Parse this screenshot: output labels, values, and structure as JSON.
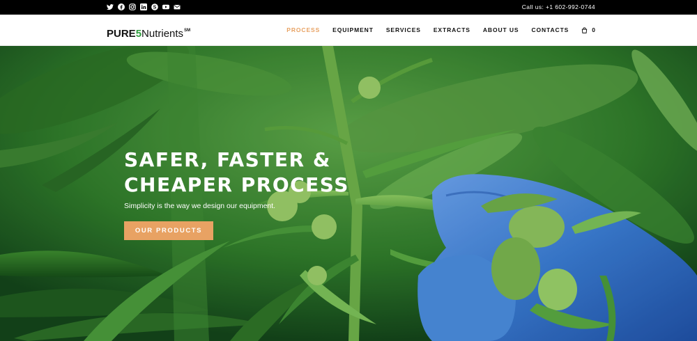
{
  "topbar": {
    "social_icons": [
      "twitter-icon",
      "facebook-icon",
      "instagram-icon",
      "linkedin-icon",
      "skype-icon",
      "youtube-icon",
      "email-icon"
    ],
    "call_text": "Call us: +1 602-992-0744"
  },
  "header": {
    "logo": {
      "part1": "PURE",
      "part2": "5",
      "part3": "Nutrients",
      "part4": "SM"
    },
    "nav": [
      {
        "label": "PROCESS",
        "active": true
      },
      {
        "label": "EQUIPMENT"
      },
      {
        "label": "SERVICES"
      },
      {
        "label": "EXTRACTS"
      },
      {
        "label": "ABOUT US"
      },
      {
        "label": "CONTACTS"
      }
    ],
    "cart_count": "0"
  },
  "hero": {
    "headline_line1": "SAFER, FASTER &",
    "headline_line2": "CHEAPER PROCESS",
    "subtext": "Simplicity is the way we design our equipment.",
    "cta_label": "OUR PRODUCTS"
  },
  "colors": {
    "accent": "#e8a263",
    "logo_green": "#2f9d3e",
    "topbar_bg": "#000000",
    "glove_blue": "#3a7bd5"
  }
}
